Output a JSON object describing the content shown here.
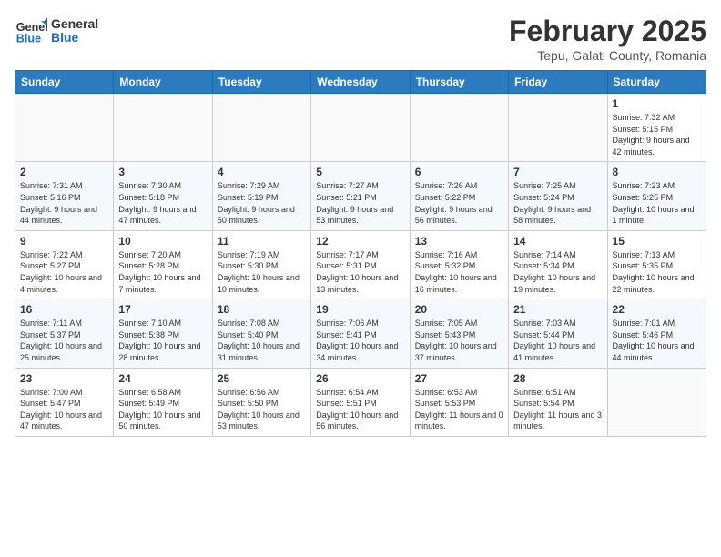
{
  "header": {
    "logo_line1": "General",
    "logo_line2": "Blue",
    "month_title": "February 2025",
    "location": "Tepu, Galati County, Romania"
  },
  "weekdays": [
    "Sunday",
    "Monday",
    "Tuesday",
    "Wednesday",
    "Thursday",
    "Friday",
    "Saturday"
  ],
  "weeks": [
    [
      {
        "num": "",
        "info": ""
      },
      {
        "num": "",
        "info": ""
      },
      {
        "num": "",
        "info": ""
      },
      {
        "num": "",
        "info": ""
      },
      {
        "num": "",
        "info": ""
      },
      {
        "num": "",
        "info": ""
      },
      {
        "num": "1",
        "info": "Sunrise: 7:32 AM\nSunset: 5:15 PM\nDaylight: 9 hours and 42 minutes."
      }
    ],
    [
      {
        "num": "2",
        "info": "Sunrise: 7:31 AM\nSunset: 5:16 PM\nDaylight: 9 hours and 44 minutes."
      },
      {
        "num": "3",
        "info": "Sunrise: 7:30 AM\nSunset: 5:18 PM\nDaylight: 9 hours and 47 minutes."
      },
      {
        "num": "4",
        "info": "Sunrise: 7:29 AM\nSunset: 5:19 PM\nDaylight: 9 hours and 50 minutes."
      },
      {
        "num": "5",
        "info": "Sunrise: 7:27 AM\nSunset: 5:21 PM\nDaylight: 9 hours and 53 minutes."
      },
      {
        "num": "6",
        "info": "Sunrise: 7:26 AM\nSunset: 5:22 PM\nDaylight: 9 hours and 56 minutes."
      },
      {
        "num": "7",
        "info": "Sunrise: 7:25 AM\nSunset: 5:24 PM\nDaylight: 9 hours and 58 minutes."
      },
      {
        "num": "8",
        "info": "Sunrise: 7:23 AM\nSunset: 5:25 PM\nDaylight: 10 hours and 1 minute."
      }
    ],
    [
      {
        "num": "9",
        "info": "Sunrise: 7:22 AM\nSunset: 5:27 PM\nDaylight: 10 hours and 4 minutes."
      },
      {
        "num": "10",
        "info": "Sunrise: 7:20 AM\nSunset: 5:28 PM\nDaylight: 10 hours and 7 minutes."
      },
      {
        "num": "11",
        "info": "Sunrise: 7:19 AM\nSunset: 5:30 PM\nDaylight: 10 hours and 10 minutes."
      },
      {
        "num": "12",
        "info": "Sunrise: 7:17 AM\nSunset: 5:31 PM\nDaylight: 10 hours and 13 minutes."
      },
      {
        "num": "13",
        "info": "Sunrise: 7:16 AM\nSunset: 5:32 PM\nDaylight: 10 hours and 16 minutes."
      },
      {
        "num": "14",
        "info": "Sunrise: 7:14 AM\nSunset: 5:34 PM\nDaylight: 10 hours and 19 minutes."
      },
      {
        "num": "15",
        "info": "Sunrise: 7:13 AM\nSunset: 5:35 PM\nDaylight: 10 hours and 22 minutes."
      }
    ],
    [
      {
        "num": "16",
        "info": "Sunrise: 7:11 AM\nSunset: 5:37 PM\nDaylight: 10 hours and 25 minutes."
      },
      {
        "num": "17",
        "info": "Sunrise: 7:10 AM\nSunset: 5:38 PM\nDaylight: 10 hours and 28 minutes."
      },
      {
        "num": "18",
        "info": "Sunrise: 7:08 AM\nSunset: 5:40 PM\nDaylight: 10 hours and 31 minutes."
      },
      {
        "num": "19",
        "info": "Sunrise: 7:06 AM\nSunset: 5:41 PM\nDaylight: 10 hours and 34 minutes."
      },
      {
        "num": "20",
        "info": "Sunrise: 7:05 AM\nSunset: 5:43 PM\nDaylight: 10 hours and 37 minutes."
      },
      {
        "num": "21",
        "info": "Sunrise: 7:03 AM\nSunset: 5:44 PM\nDaylight: 10 hours and 41 minutes."
      },
      {
        "num": "22",
        "info": "Sunrise: 7:01 AM\nSunset: 5:46 PM\nDaylight: 10 hours and 44 minutes."
      }
    ],
    [
      {
        "num": "23",
        "info": "Sunrise: 7:00 AM\nSunset: 5:47 PM\nDaylight: 10 hours and 47 minutes."
      },
      {
        "num": "24",
        "info": "Sunrise: 6:58 AM\nSunset: 5:49 PM\nDaylight: 10 hours and 50 minutes."
      },
      {
        "num": "25",
        "info": "Sunrise: 6:56 AM\nSunset: 5:50 PM\nDaylight: 10 hours and 53 minutes."
      },
      {
        "num": "26",
        "info": "Sunrise: 6:54 AM\nSunset: 5:51 PM\nDaylight: 10 hours and 56 minutes."
      },
      {
        "num": "27",
        "info": "Sunrise: 6:53 AM\nSunset: 5:53 PM\nDaylight: 11 hours and 0 minutes."
      },
      {
        "num": "28",
        "info": "Sunrise: 6:51 AM\nSunset: 5:54 PM\nDaylight: 11 hours and 3 minutes."
      },
      {
        "num": "",
        "info": ""
      }
    ]
  ]
}
